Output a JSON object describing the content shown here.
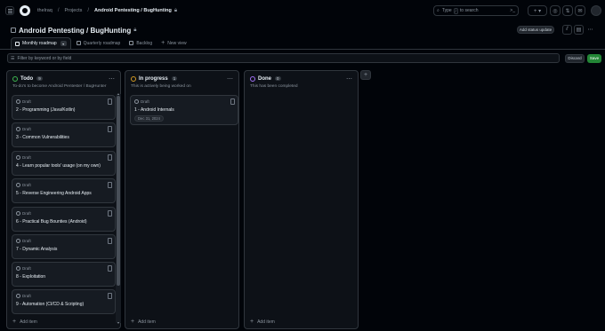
{
  "header": {
    "crumbs": [
      "thelraq",
      "Projects",
      "Android Pentesting / BugHunting"
    ],
    "search_prefix": "Type",
    "search_key": "/",
    "search_suffix": "to search",
    "search_right": ">_"
  },
  "project": {
    "title": "Android Pentesting / BugHunting",
    "status_button": "Add status update"
  },
  "tabs": [
    {
      "label": "Monthly roadmap",
      "active": true
    },
    {
      "label": "Quarterly roadmap",
      "active": false
    },
    {
      "label": "Backlog",
      "active": false
    }
  ],
  "new_view": "New view",
  "filter": {
    "placeholder": "Filter by keyword or by field",
    "discard": "Discard",
    "save": "Save"
  },
  "columns": [
    {
      "title": "Todo",
      "count": "9",
      "color": "#3fb950",
      "description": "To-do's to become Android Pentester / BugHunter",
      "cards": [
        {
          "status": "Draft",
          "name": "2 - Programming (Java/Kotlin)"
        },
        {
          "status": "Draft",
          "name": "3 - Common Vulnerabilities"
        },
        {
          "status": "Draft",
          "name": "4 - Learn popular tools' usage (on my own)"
        },
        {
          "status": "Draft",
          "name": "5 - Reverse Engineering Android Apps"
        },
        {
          "status": "Draft",
          "name": "6 - Practical Bug Bounties (Android)"
        },
        {
          "status": "Draft",
          "name": "7 - Dynamic Analysis"
        },
        {
          "status": "Draft",
          "name": "8 - Exploitation"
        },
        {
          "status": "Draft",
          "name": "9 - Automation (CI/CD & Scripting)"
        }
      ],
      "add_item": "Add item"
    },
    {
      "title": "In progress",
      "count": "1",
      "color": "#d29922",
      "description": "This is actively being worked on",
      "cards": [
        {
          "status": "Draft",
          "name": "1 - Android Internals",
          "date": "Dec 31, 2024"
        }
      ],
      "add_item": "Add item"
    },
    {
      "title": "Done",
      "count": "0",
      "color": "#a371f7",
      "description": "This has been completed",
      "cards": [],
      "add_item": "Add item"
    }
  ]
}
